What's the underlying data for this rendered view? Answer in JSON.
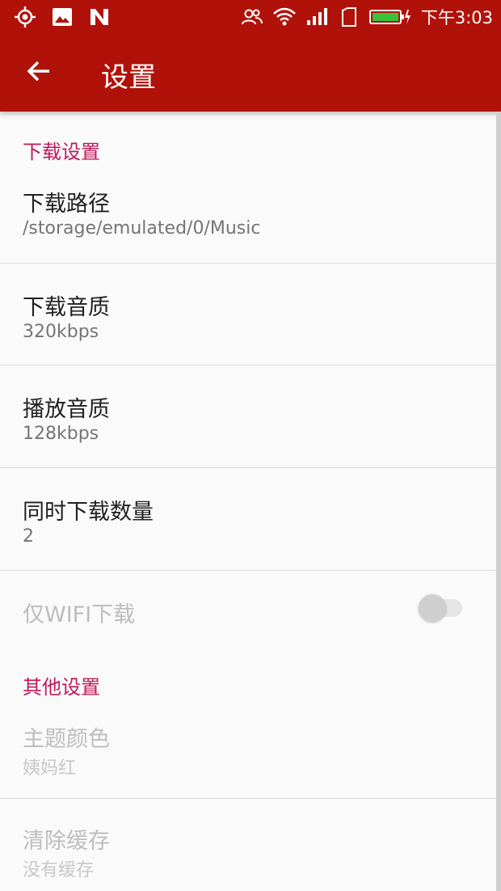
{
  "status_bar": {
    "time": "下午3:03",
    "left_icons": [
      "location-target-icon",
      "image-icon",
      "n-app-icon"
    ],
    "right_icons": [
      "contacts-icon",
      "wifi-icon",
      "signal-icon",
      "sim-icon",
      "battery-icon"
    ]
  },
  "app_bar": {
    "title": "设置",
    "back_icon": "arrow-back-icon",
    "background": "#b0120a"
  },
  "sections": {
    "download_header": "下载设置",
    "other_header": "其他设置"
  },
  "prefs": {
    "download_path": {
      "title": "下载路径",
      "summary": "/storage/emulated/0/Music"
    },
    "download_quality": {
      "title": "下载音质",
      "summary": "320kbps"
    },
    "play_quality": {
      "title": "播放音质",
      "summary": "128kbps"
    },
    "concurrent_downloads": {
      "title": "同时下载数量",
      "summary": "2"
    },
    "wifi_only": {
      "title": "仅WIFI下载",
      "enabled": false,
      "checked": false
    },
    "theme_color": {
      "title": "主题颜色",
      "summary": "姨妈红"
    },
    "clear_cache": {
      "title": "清除缓存",
      "summary": "没有缓存"
    }
  },
  "colors": {
    "accent": "#c2185b",
    "primary": "#b0120a"
  }
}
